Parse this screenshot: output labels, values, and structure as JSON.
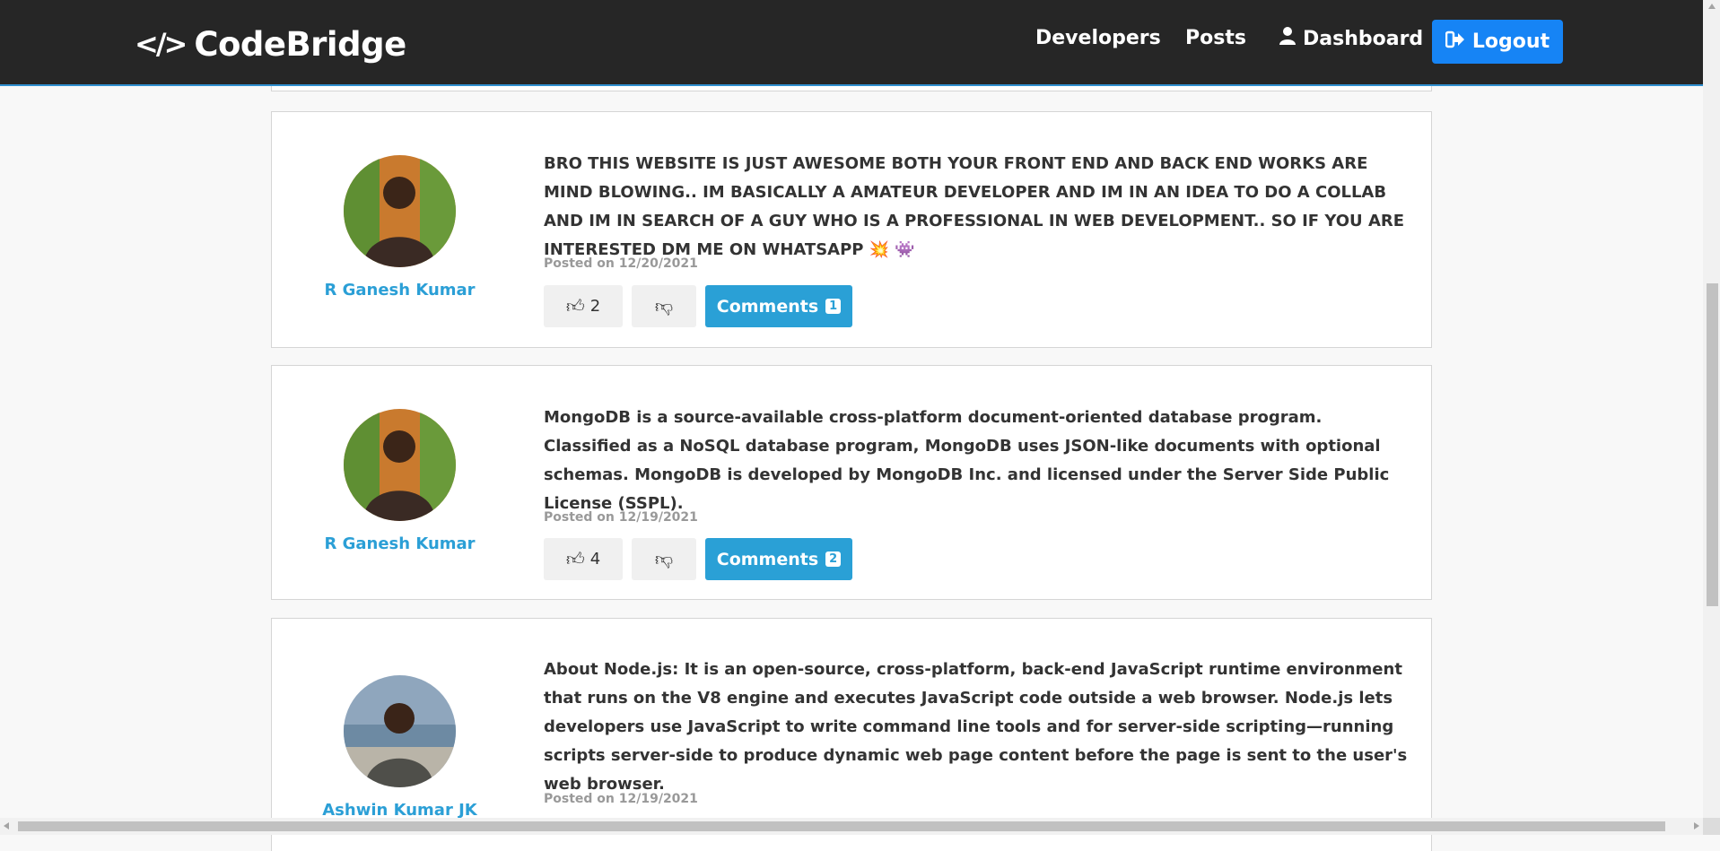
{
  "navbar": {
    "brand_icon": "</>",
    "brand_name": "CodeBridge",
    "links": {
      "developers": "Developers",
      "posts": "Posts",
      "dashboard": "Dashboard",
      "logout": "Logout"
    },
    "icons": {
      "dashboard": "user-icon",
      "logout": "sign-out-icon"
    },
    "colors": {
      "background": "#262626",
      "logout_button": "#1684f5"
    }
  },
  "posts": [
    {
      "author": "R Ganesh Kumar",
      "text": "BRO THIS WEBSITE IS JUST AWESOME BOTH YOUR FRONT END AND BACK END WORKS ARE MIND BLOWING.. IM BASICALLY A AMATEUR DEVELOPER AND IM IN AN IDEA TO DO A COLLAB AND IM IN SEARCH OF A GUY WHO IS A PROFESSIONAL IN WEB DEVELOPMENT.. SO IF YOU ARE INTERESTED DM ME ON WHATSAPP 💥 👾",
      "date": "Posted on 12/20/2021",
      "likes": "2",
      "comments_label": "Comments",
      "comments_count": "1"
    },
    {
      "author": "R Ganesh Kumar",
      "text": "MongoDB is a source-available cross-platform document-oriented database program. Classified as a NoSQL database program, MongoDB uses JSON-like documents with optional schemas. MongoDB is developed by MongoDB Inc. and licensed under the Server Side Public License (SSPL).",
      "date": "Posted on 12/19/2021",
      "likes": "4",
      "comments_label": "Comments",
      "comments_count": "2"
    },
    {
      "author": "Ashwin Kumar JK",
      "text": "About Node.js: It is an open-source, cross-platform, back-end JavaScript runtime environment that runs on the V8 engine and executes JavaScript code outside a web browser. Node.js lets developers use JavaScript to write command line tools and for server-side scripting—running scripts server-side to produce dynamic web page content before the page is sent to the user's web browser.",
      "date": "Posted on 12/19/2021"
    }
  ],
  "icons": {
    "like": "thumbs-up-icon",
    "dislike": "thumbs-down-icon"
  },
  "colors": {
    "author_link": "#2b9fd6",
    "comments_button": "#2aa0d6",
    "delete_button": "#dc3545"
  }
}
